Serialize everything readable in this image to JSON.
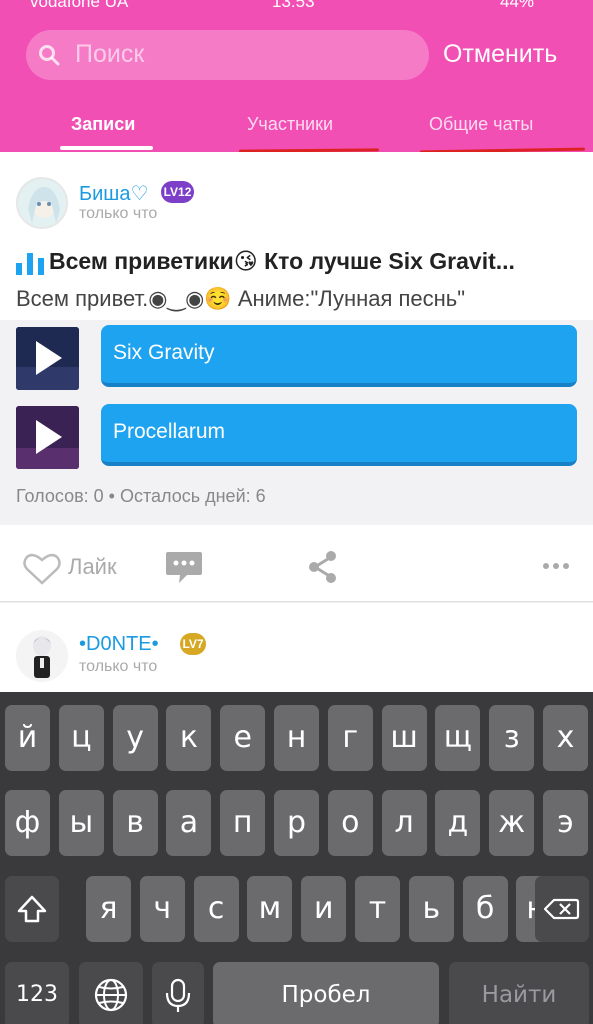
{
  "status": {
    "carrier": "vodafone UA",
    "time": "13:53",
    "battery": "44%"
  },
  "search": {
    "placeholder": "Поиск",
    "cancel": "Отменить"
  },
  "tabs": [
    {
      "label": "Записи"
    },
    {
      "label": "Участники"
    },
    {
      "label": "Общие чаты"
    }
  ],
  "post1": {
    "author": "Биша♡",
    "level": "LV12",
    "time": "только что",
    "title": "Всем приветики😘 Кто лучше Six Gravit...",
    "body": "Всем привет.◉‿◉☺️ Аниме:\"Лунная песнь\"",
    "options": [
      {
        "label": "Six Gravity"
      },
      {
        "label": "Procellarum"
      }
    ],
    "stats": "Голосов: 0 • Осталось дней: 6",
    "like_label": "Лайк"
  },
  "post2": {
    "author": "•D0NTE•",
    "level": "LV7",
    "time": "только что"
  },
  "keyboard": {
    "row1": [
      "й",
      "ц",
      "у",
      "к",
      "е",
      "н",
      "г",
      "ш",
      "щ",
      "з",
      "х"
    ],
    "row2": [
      "ф",
      "ы",
      "в",
      "а",
      "п",
      "р",
      "о",
      "л",
      "д",
      "ж",
      "э"
    ],
    "row3": [
      "я",
      "ч",
      "с",
      "м",
      "и",
      "т",
      "ь",
      "б",
      "ю"
    ],
    "numbers": "123",
    "space": "Пробел",
    "go": "Найти"
  },
  "colors": {
    "header": "#f24fb5",
    "accent": "#1ea3f0",
    "name": "#1a9be0"
  }
}
